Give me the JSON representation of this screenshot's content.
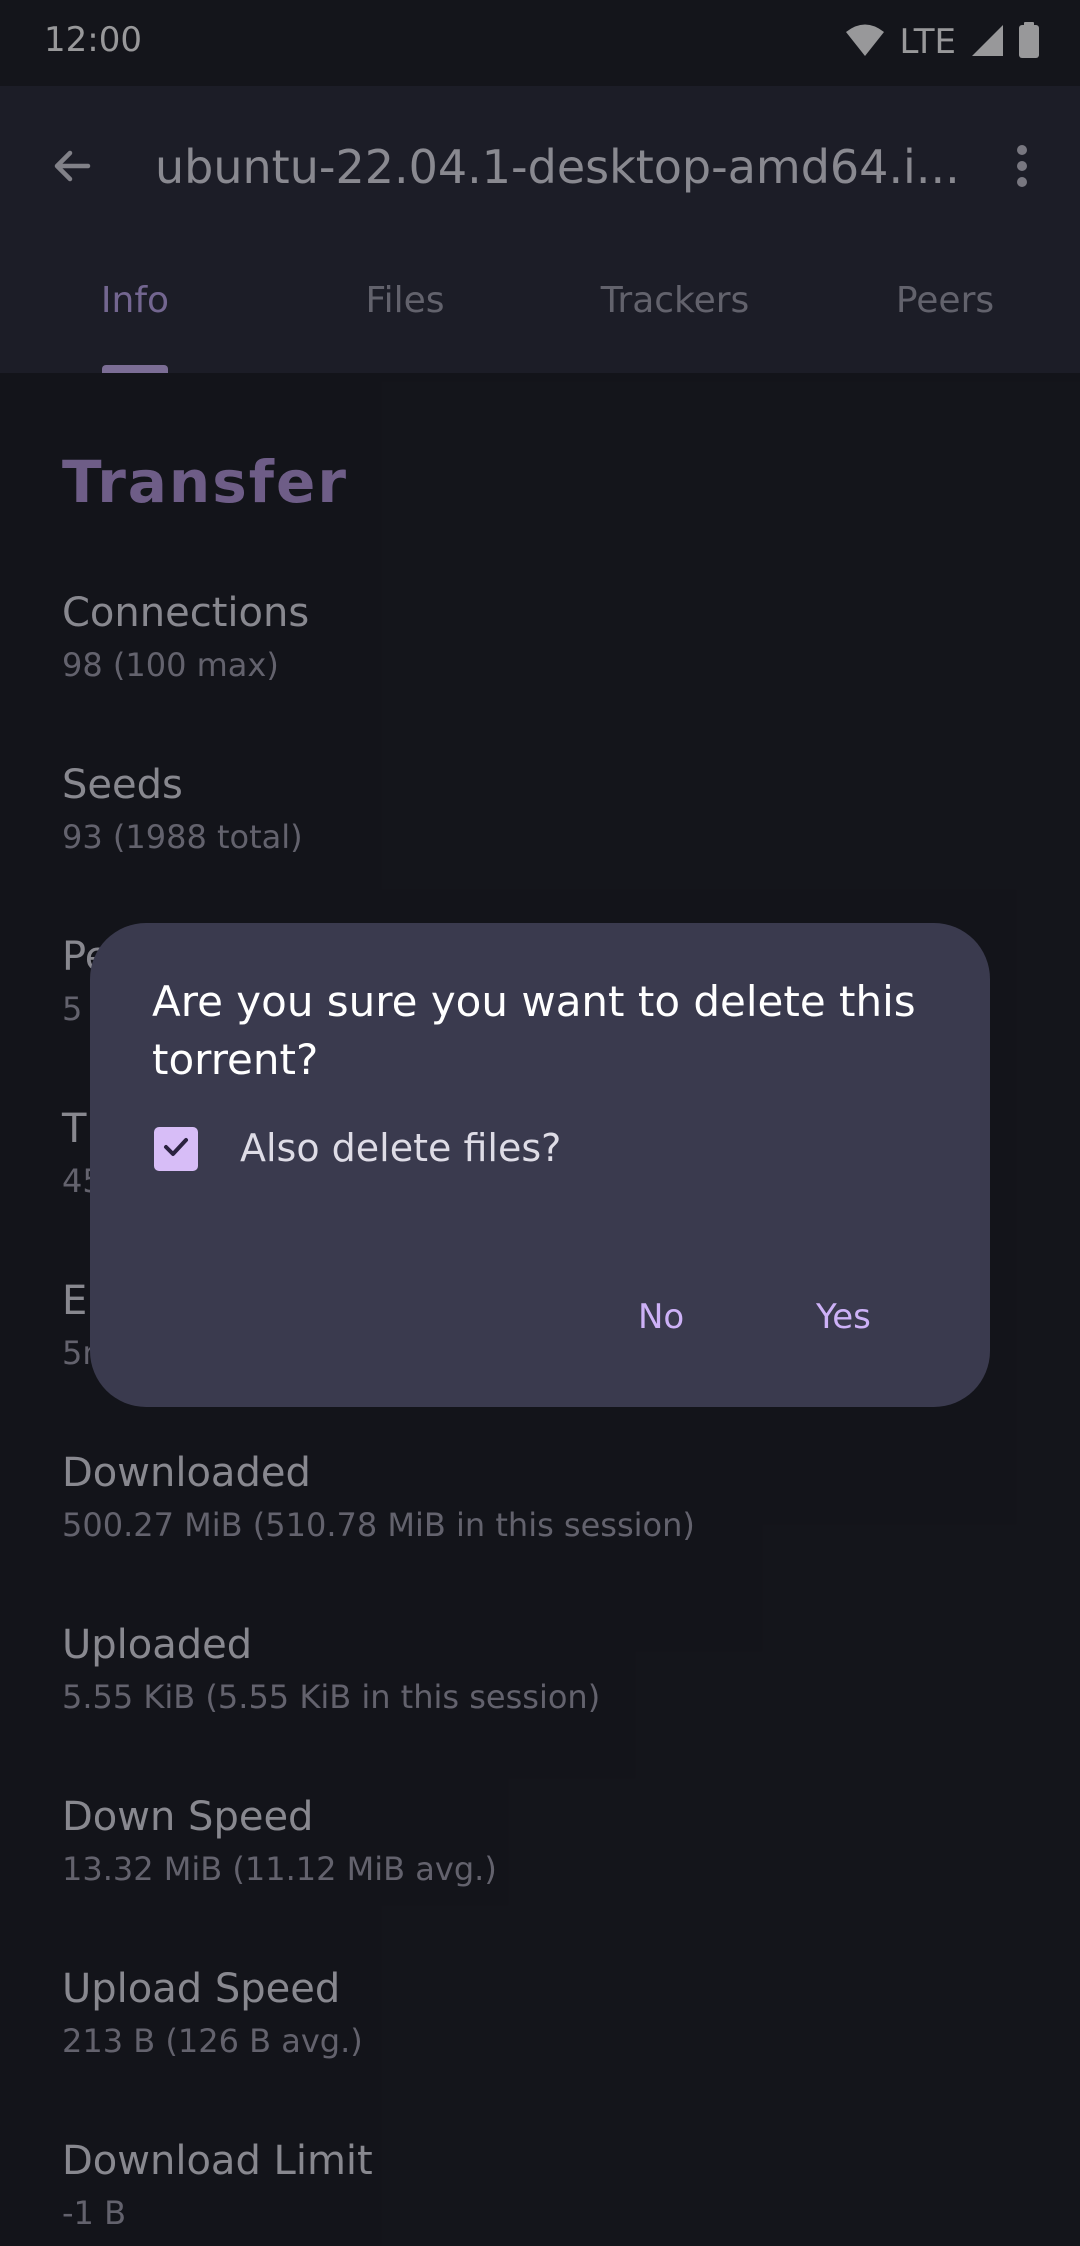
{
  "status_bar": {
    "time": "12:00",
    "network": "LTE",
    "icons": [
      "wifi-icon",
      "signal-icon",
      "battery-icon"
    ]
  },
  "app_bar": {
    "title": "ubuntu-22.04.1-desktop-amd64.i...",
    "back_icon": "arrow-back-icon",
    "more_icon": "more-vert-icon"
  },
  "tabs": [
    {
      "label": "Info",
      "active": true
    },
    {
      "label": "Files",
      "active": false
    },
    {
      "label": "Trackers",
      "active": false
    },
    {
      "label": "Peers",
      "active": false
    }
  ],
  "section": {
    "title": "Transfer",
    "items": [
      {
        "label": "Connections",
        "value": "98 (100 max)"
      },
      {
        "label": "Seeds",
        "value": "93 (1988 total)"
      },
      {
        "label": "Pe",
        "value": "5"
      },
      {
        "label": "T",
        "value": "45"
      },
      {
        "label": "E",
        "value": "5n"
      },
      {
        "label": "Downloaded",
        "value": "500.27 MiB (510.78 MiB in this session)"
      },
      {
        "label": "Uploaded",
        "value": "5.55 KiB (5.55 KiB in this session)"
      },
      {
        "label": "Down Speed",
        "value": "13.32 MiB (11.12 MiB avg.)"
      },
      {
        "label": "Upload Speed",
        "value": "213 B (126 B avg.)"
      },
      {
        "label": "Download Limit",
        "value": "-1 B"
      }
    ]
  },
  "dialog": {
    "title": "Are you sure you want to delete this torrent?",
    "checkbox_label": "Also delete files?",
    "checkbox_checked": true,
    "no_label": "No",
    "yes_label": "Yes"
  },
  "colors": {
    "accent": "#bfa9ee",
    "section_title": "#b79adf",
    "background": "#1b1d24",
    "app_bar": "#2a2c3a",
    "dialog": "#3a3a4e"
  }
}
